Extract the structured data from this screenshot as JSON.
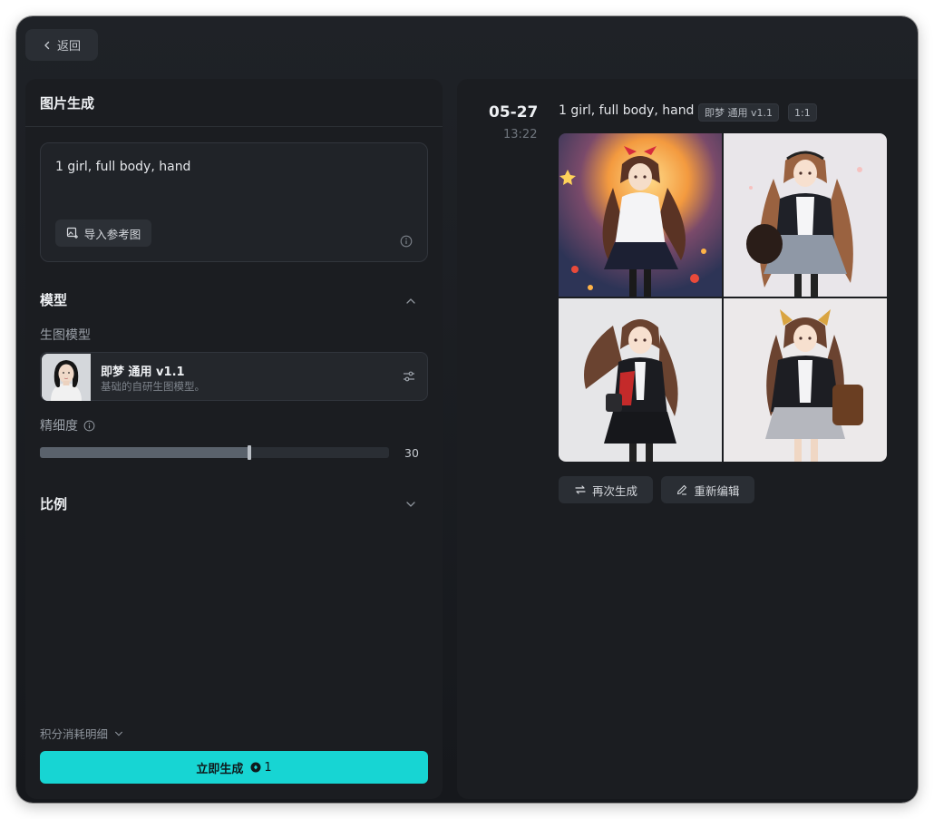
{
  "header": {
    "back_label": "返回"
  },
  "left": {
    "panel_title": "图片生成",
    "prompt": "1 girl, full body, hand",
    "import_ref_label": "导入参考图",
    "model_section": "模型",
    "gen_model_label": "生图模型",
    "model": {
      "name": "即梦 通用 v1.1",
      "desc": "基础的自研生图模型。"
    },
    "detail_label": "精细度",
    "detail": {
      "value": 30,
      "min": 0,
      "max": 50,
      "value_text": "30"
    },
    "ratio_section": "比例",
    "points_detail": "积分消耗明细",
    "generate_label": "立即生成",
    "generate_cost": "1"
  },
  "right": {
    "date": "05-27",
    "time": "13:22",
    "prompt": "1 girl, full body, hand",
    "model_tag": "即梦 通用 v1.1",
    "ratio_tag": "1:1",
    "regenerate_label": "再次生成",
    "reedit_label": "重新编辑"
  },
  "colors": {
    "accent": "#17d5d3",
    "panel": "#1b1d21",
    "background": "#16181c"
  },
  "icons": [
    "chevron-left-icon",
    "image-import-icon",
    "info-icon",
    "chevron-up-icon",
    "chevron-down-icon",
    "sliders-icon",
    "coin-icon",
    "refresh-icon",
    "pencil-icon"
  ]
}
